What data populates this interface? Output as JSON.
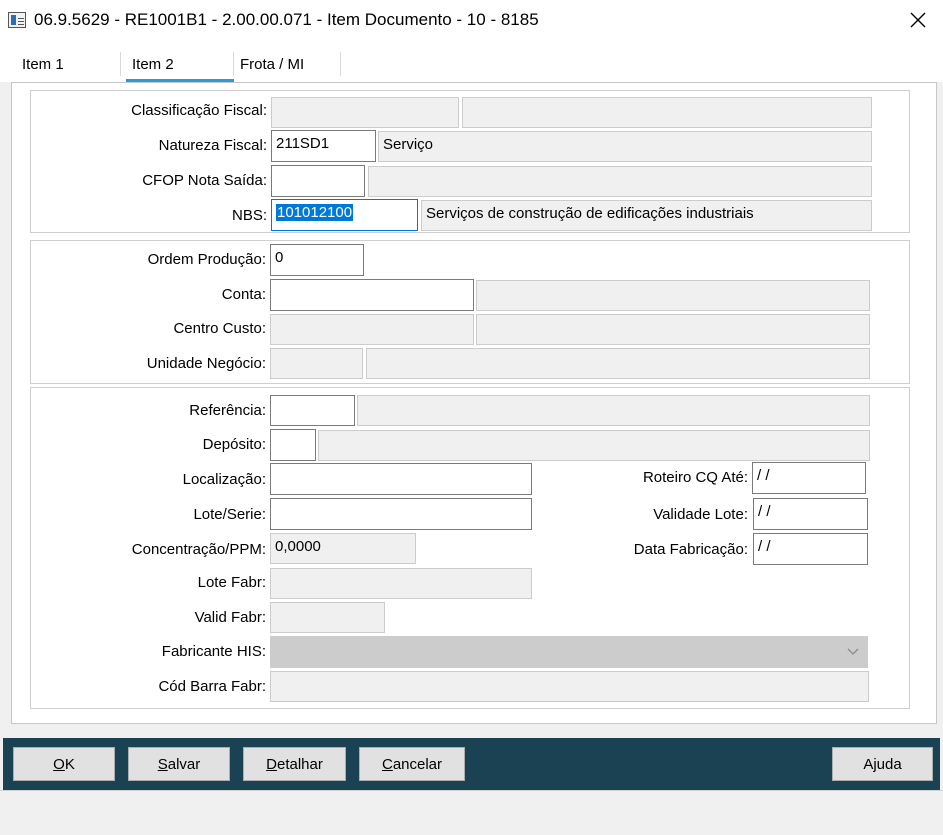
{
  "window": {
    "title": "06.9.5629 - RE1001B1 - 2.00.00.071 - Item Documento - 10 - 8185"
  },
  "tabs": [
    {
      "label": "Item 1"
    },
    {
      "label": "Item 2"
    },
    {
      "label": "Frota / MI"
    }
  ],
  "fiscal": {
    "classificacao_label": "Classificação Fiscal:",
    "natureza_label": "Natureza Fiscal:",
    "natureza_value": "211SD1",
    "natureza_desc": "Serviço",
    "cfop_label": "CFOP Nota Saída:",
    "nbs_label": "NBS:",
    "nbs_value": "101012100",
    "nbs_desc": "Serviços de construção de edificações industriais"
  },
  "producao": {
    "ordem_label": "Ordem Produção:",
    "ordem_value": "0",
    "conta_label": "Conta:",
    "centro_label": "Centro Custo:",
    "unidade_label": "Unidade Negócio:"
  },
  "estoque": {
    "referencia_label": "Referência:",
    "deposito_label": "Depósito:",
    "localizacao_label": "Localização:",
    "lote_label": "Lote/Serie:",
    "concentracao_label": "Concentração/PPM:",
    "concentracao_value": "0,0000",
    "lote_fabr_label": "Lote Fabr:",
    "valid_fabr_label": "Valid Fabr:",
    "fabricante_label": "Fabricante HIS:",
    "cod_barra_label": "Cód Barra Fabr:",
    "roteiro_label": "Roteiro CQ Até:",
    "roteiro_value": " / /",
    "validade_label": "Validade Lote:",
    "validade_value": " / /",
    "data_fab_label": "Data Fabricação:",
    "data_fab_value": " / /"
  },
  "buttons": {
    "ok": {
      "first": "O",
      "rest": "K"
    },
    "salvar": {
      "first": "S",
      "rest": "alvar"
    },
    "detalhar": {
      "first": "D",
      "rest": "etalhar"
    },
    "cancelar": {
      "first": "C",
      "rest": "ancelar"
    },
    "ajuda": "Ajuda"
  },
  "icons": {
    "app": "app-window-icon",
    "close": "close-icon",
    "dropdown": "chevron-down-icon"
  },
  "colors": {
    "accent": "#2a9bd8",
    "bottom_bar": "#1b4253",
    "selection": "#0078d7"
  }
}
